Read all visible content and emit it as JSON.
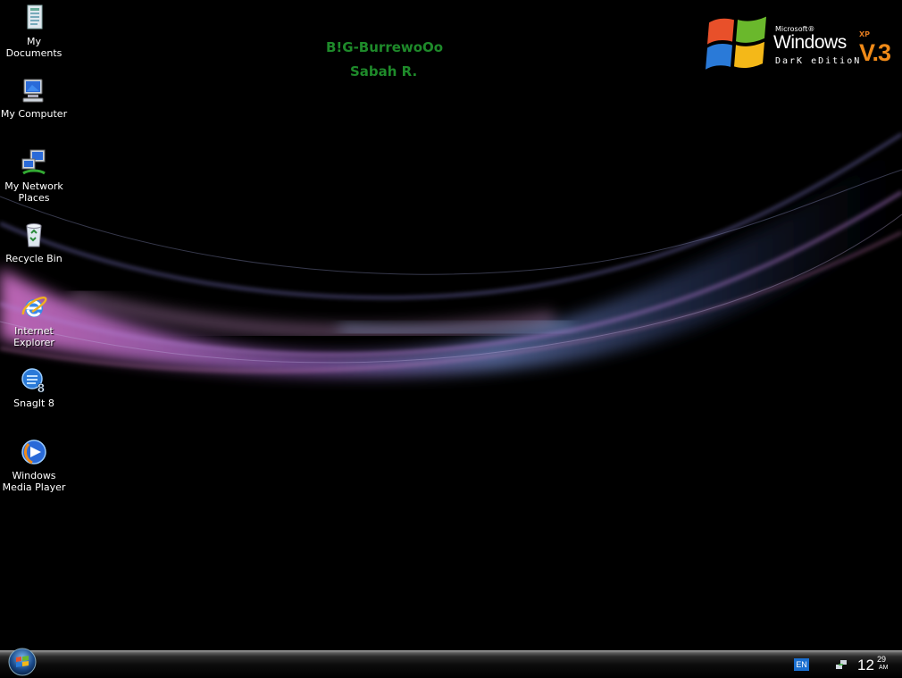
{
  "desktop_icons": [
    {
      "label": "My Documents",
      "icon": "my-documents-icon"
    },
    {
      "label": "My Computer",
      "icon": "my-computer-icon"
    },
    {
      "label": "My Network Places",
      "icon": "network-places-icon"
    },
    {
      "label": "Recycle Bin",
      "icon": "recycle-bin-icon"
    },
    {
      "label": "Internet Explorer",
      "icon": "internet-explorer-icon"
    },
    {
      "label": "SnagIt 8",
      "icon": "snagit-icon"
    },
    {
      "label": "Windows Media Player",
      "icon": "media-player-icon"
    }
  ],
  "signature": {
    "line1": "B!G-BurrewoOo",
    "line2": "Sabah R."
  },
  "logo": {
    "brand": "Microsoft®",
    "product": "Windows",
    "superscript": "XP",
    "edition": "DarK eDitioN",
    "version": "V.3"
  },
  "taskbar": {
    "language": "EN",
    "clock": {
      "hours": "12",
      "minutes": "29",
      "ampm": "AM"
    }
  },
  "colors": {
    "signature_green": "#1e8a2a",
    "version_orange": "#f08a18",
    "desktop_bg": "#000000"
  }
}
